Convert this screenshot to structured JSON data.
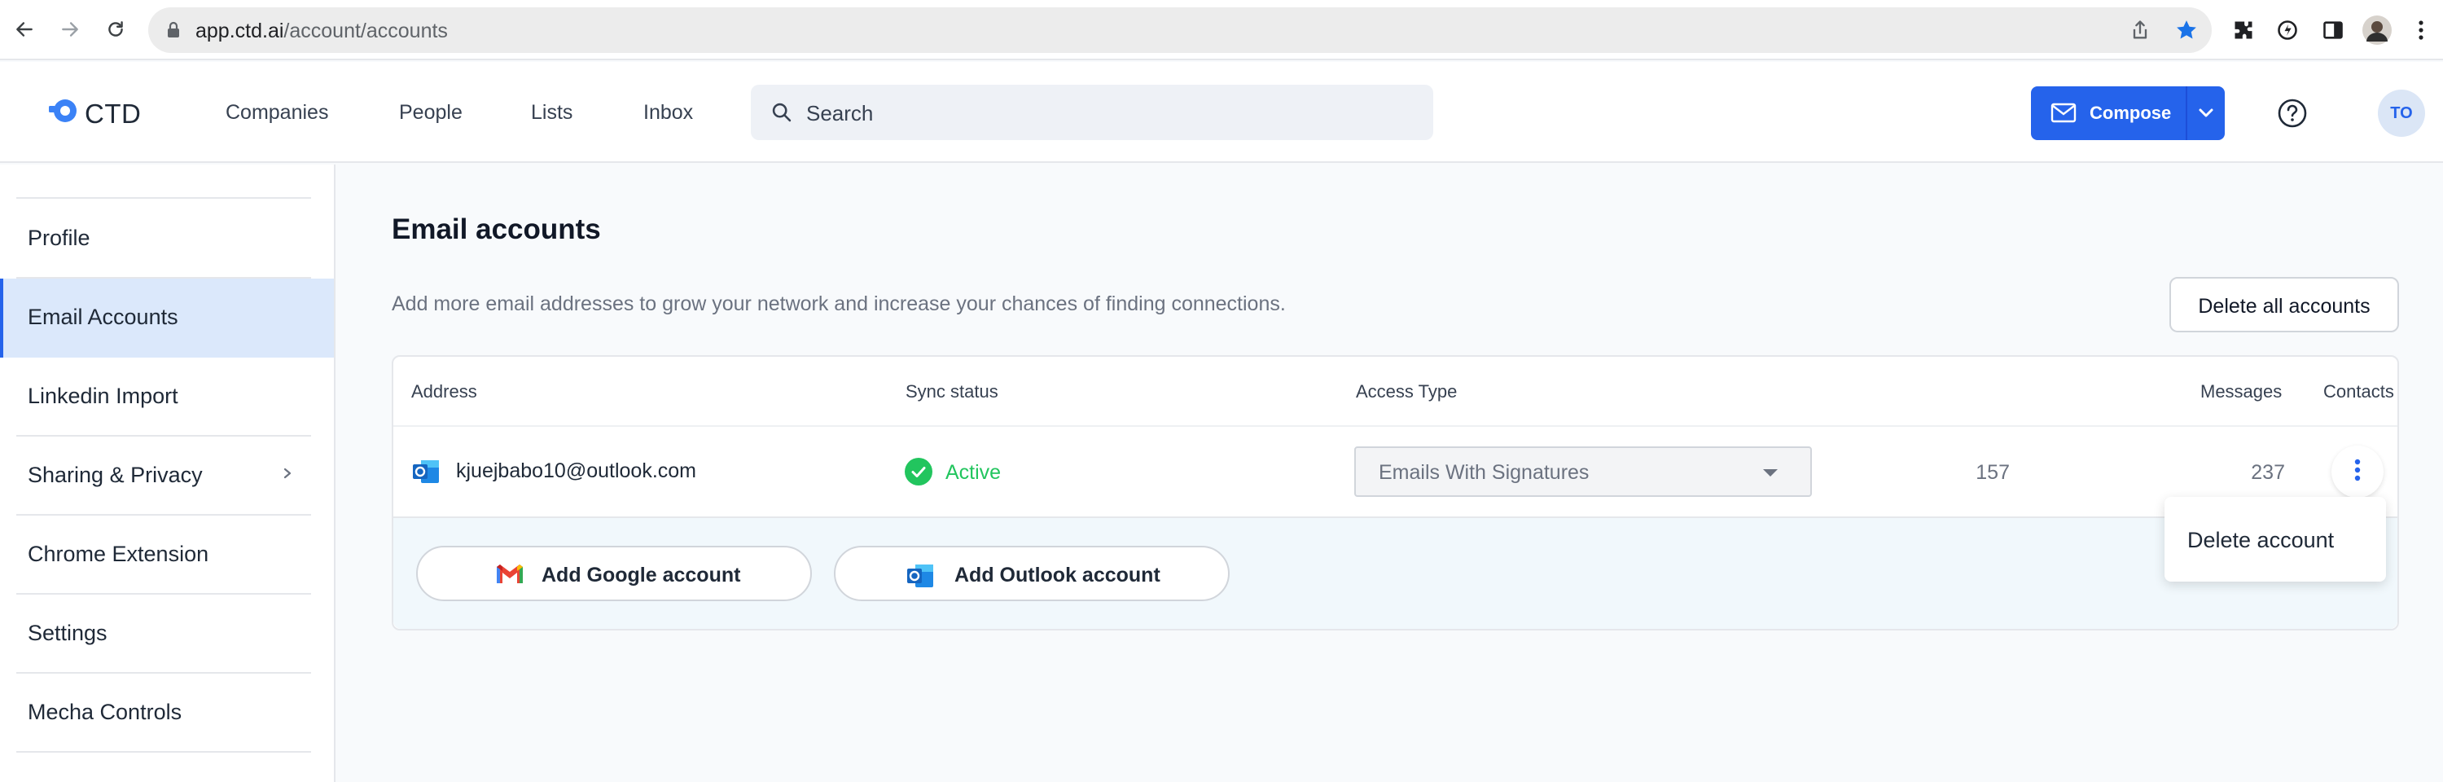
{
  "browser": {
    "url_host": "app.ctd.ai",
    "url_path": "/account/accounts"
  },
  "header": {
    "logo_text": "CTD",
    "nav": [
      "Companies",
      "People",
      "Lists",
      "Inbox"
    ],
    "search_placeholder": "Search",
    "compose_label": "Compose",
    "avatar_initials": "TO"
  },
  "sidebar": {
    "items": [
      {
        "label": "Profile"
      },
      {
        "label": "Email Accounts"
      },
      {
        "label": "Linkedin Import"
      },
      {
        "label": "Sharing & Privacy"
      },
      {
        "label": "Chrome Extension"
      },
      {
        "label": "Settings"
      },
      {
        "label": "Mecha Controls"
      }
    ],
    "active": "Email Accounts"
  },
  "main": {
    "title": "Email accounts",
    "description": "Add more email addresses to grow your network and increase your chances of finding connections.",
    "delete_all_label": "Delete all accounts",
    "columns": [
      "Address",
      "Sync status",
      "Access Type",
      "Contacts",
      "Messages"
    ],
    "accounts": [
      {
        "address": "kjuejbabo10@outlook.com",
        "sync_status": "Active",
        "access_type": "Emails With Signatures",
        "contacts": "157",
        "messages": "237"
      }
    ],
    "add_google_label": "Add Google account",
    "add_outlook_label": "Add Outlook account",
    "row_menu": [
      "Delete account"
    ]
  },
  "colors": {
    "accent": "#2563eb",
    "active_bg": "#dbe8fb",
    "status_green": "#22c55e"
  }
}
